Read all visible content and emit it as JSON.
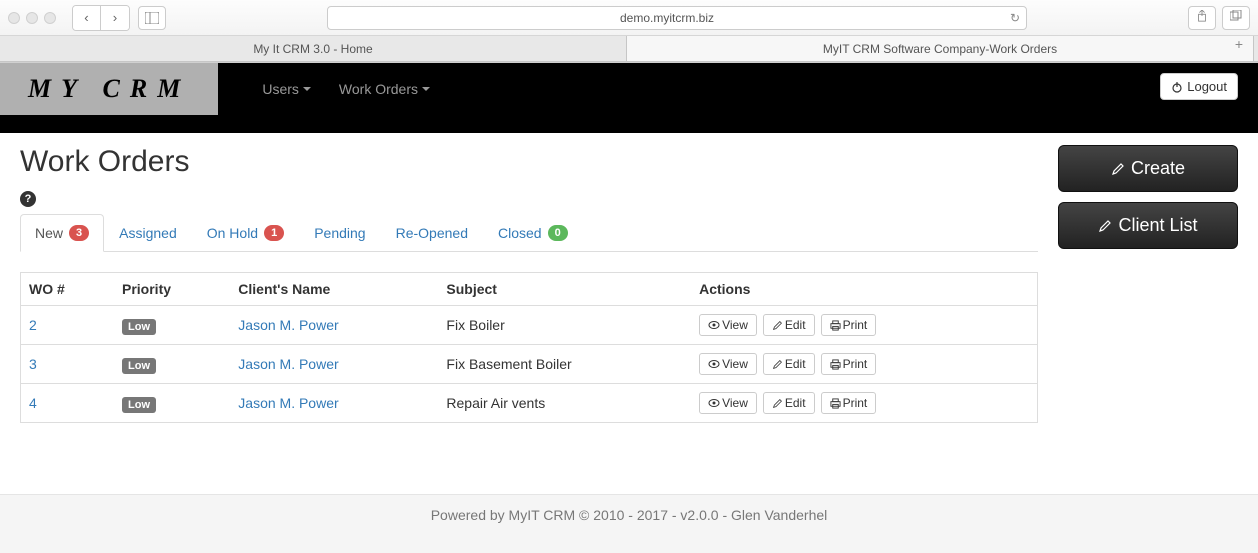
{
  "browser": {
    "url": "demo.myitcrm.biz",
    "tabs": [
      {
        "label": "My It CRM 3.0 - Home",
        "active": false
      },
      {
        "label": "MyIT CRM Software Company-Work Orders",
        "active": true
      }
    ]
  },
  "app": {
    "logo": "MY CRM",
    "menu": {
      "users": "Users",
      "work_orders": "Work Orders"
    },
    "logout": "Logout"
  },
  "page": {
    "title": "Work Orders"
  },
  "tabs": [
    {
      "key": "new",
      "label": "New",
      "badge": "3",
      "badge_color": "red",
      "active": true
    },
    {
      "key": "assigned",
      "label": "Assigned",
      "badge": null,
      "active": false
    },
    {
      "key": "onhold",
      "label": "On Hold",
      "badge": "1",
      "badge_color": "red",
      "active": false
    },
    {
      "key": "pending",
      "label": "Pending",
      "badge": null,
      "active": false
    },
    {
      "key": "reopened",
      "label": "Re-Opened",
      "badge": null,
      "active": false
    },
    {
      "key": "closed",
      "label": "Closed",
      "badge": "0",
      "badge_color": "green",
      "active": false
    }
  ],
  "table": {
    "headers": {
      "wo": "WO #",
      "priority": "Priority",
      "client": "Client's Name",
      "subject": "Subject",
      "actions": "Actions"
    },
    "rows": [
      {
        "wo": "2",
        "priority": "Low",
        "client": "Jason M. Power",
        "subject": "Fix Boiler"
      },
      {
        "wo": "3",
        "priority": "Low",
        "client": "Jason M. Power",
        "subject": "Fix Basement Boiler"
      },
      {
        "wo": "4",
        "priority": "Low",
        "client": "Jason M. Power",
        "subject": "Repair Air vents"
      }
    ],
    "action_labels": {
      "view": "View",
      "edit": "Edit",
      "print": "Print"
    }
  },
  "side": {
    "create": "Create",
    "client_list": "Client List"
  },
  "footer": "Powered by MyIT CRM © 2010 - 2017 - v2.0.0 - Glen Vanderhel"
}
